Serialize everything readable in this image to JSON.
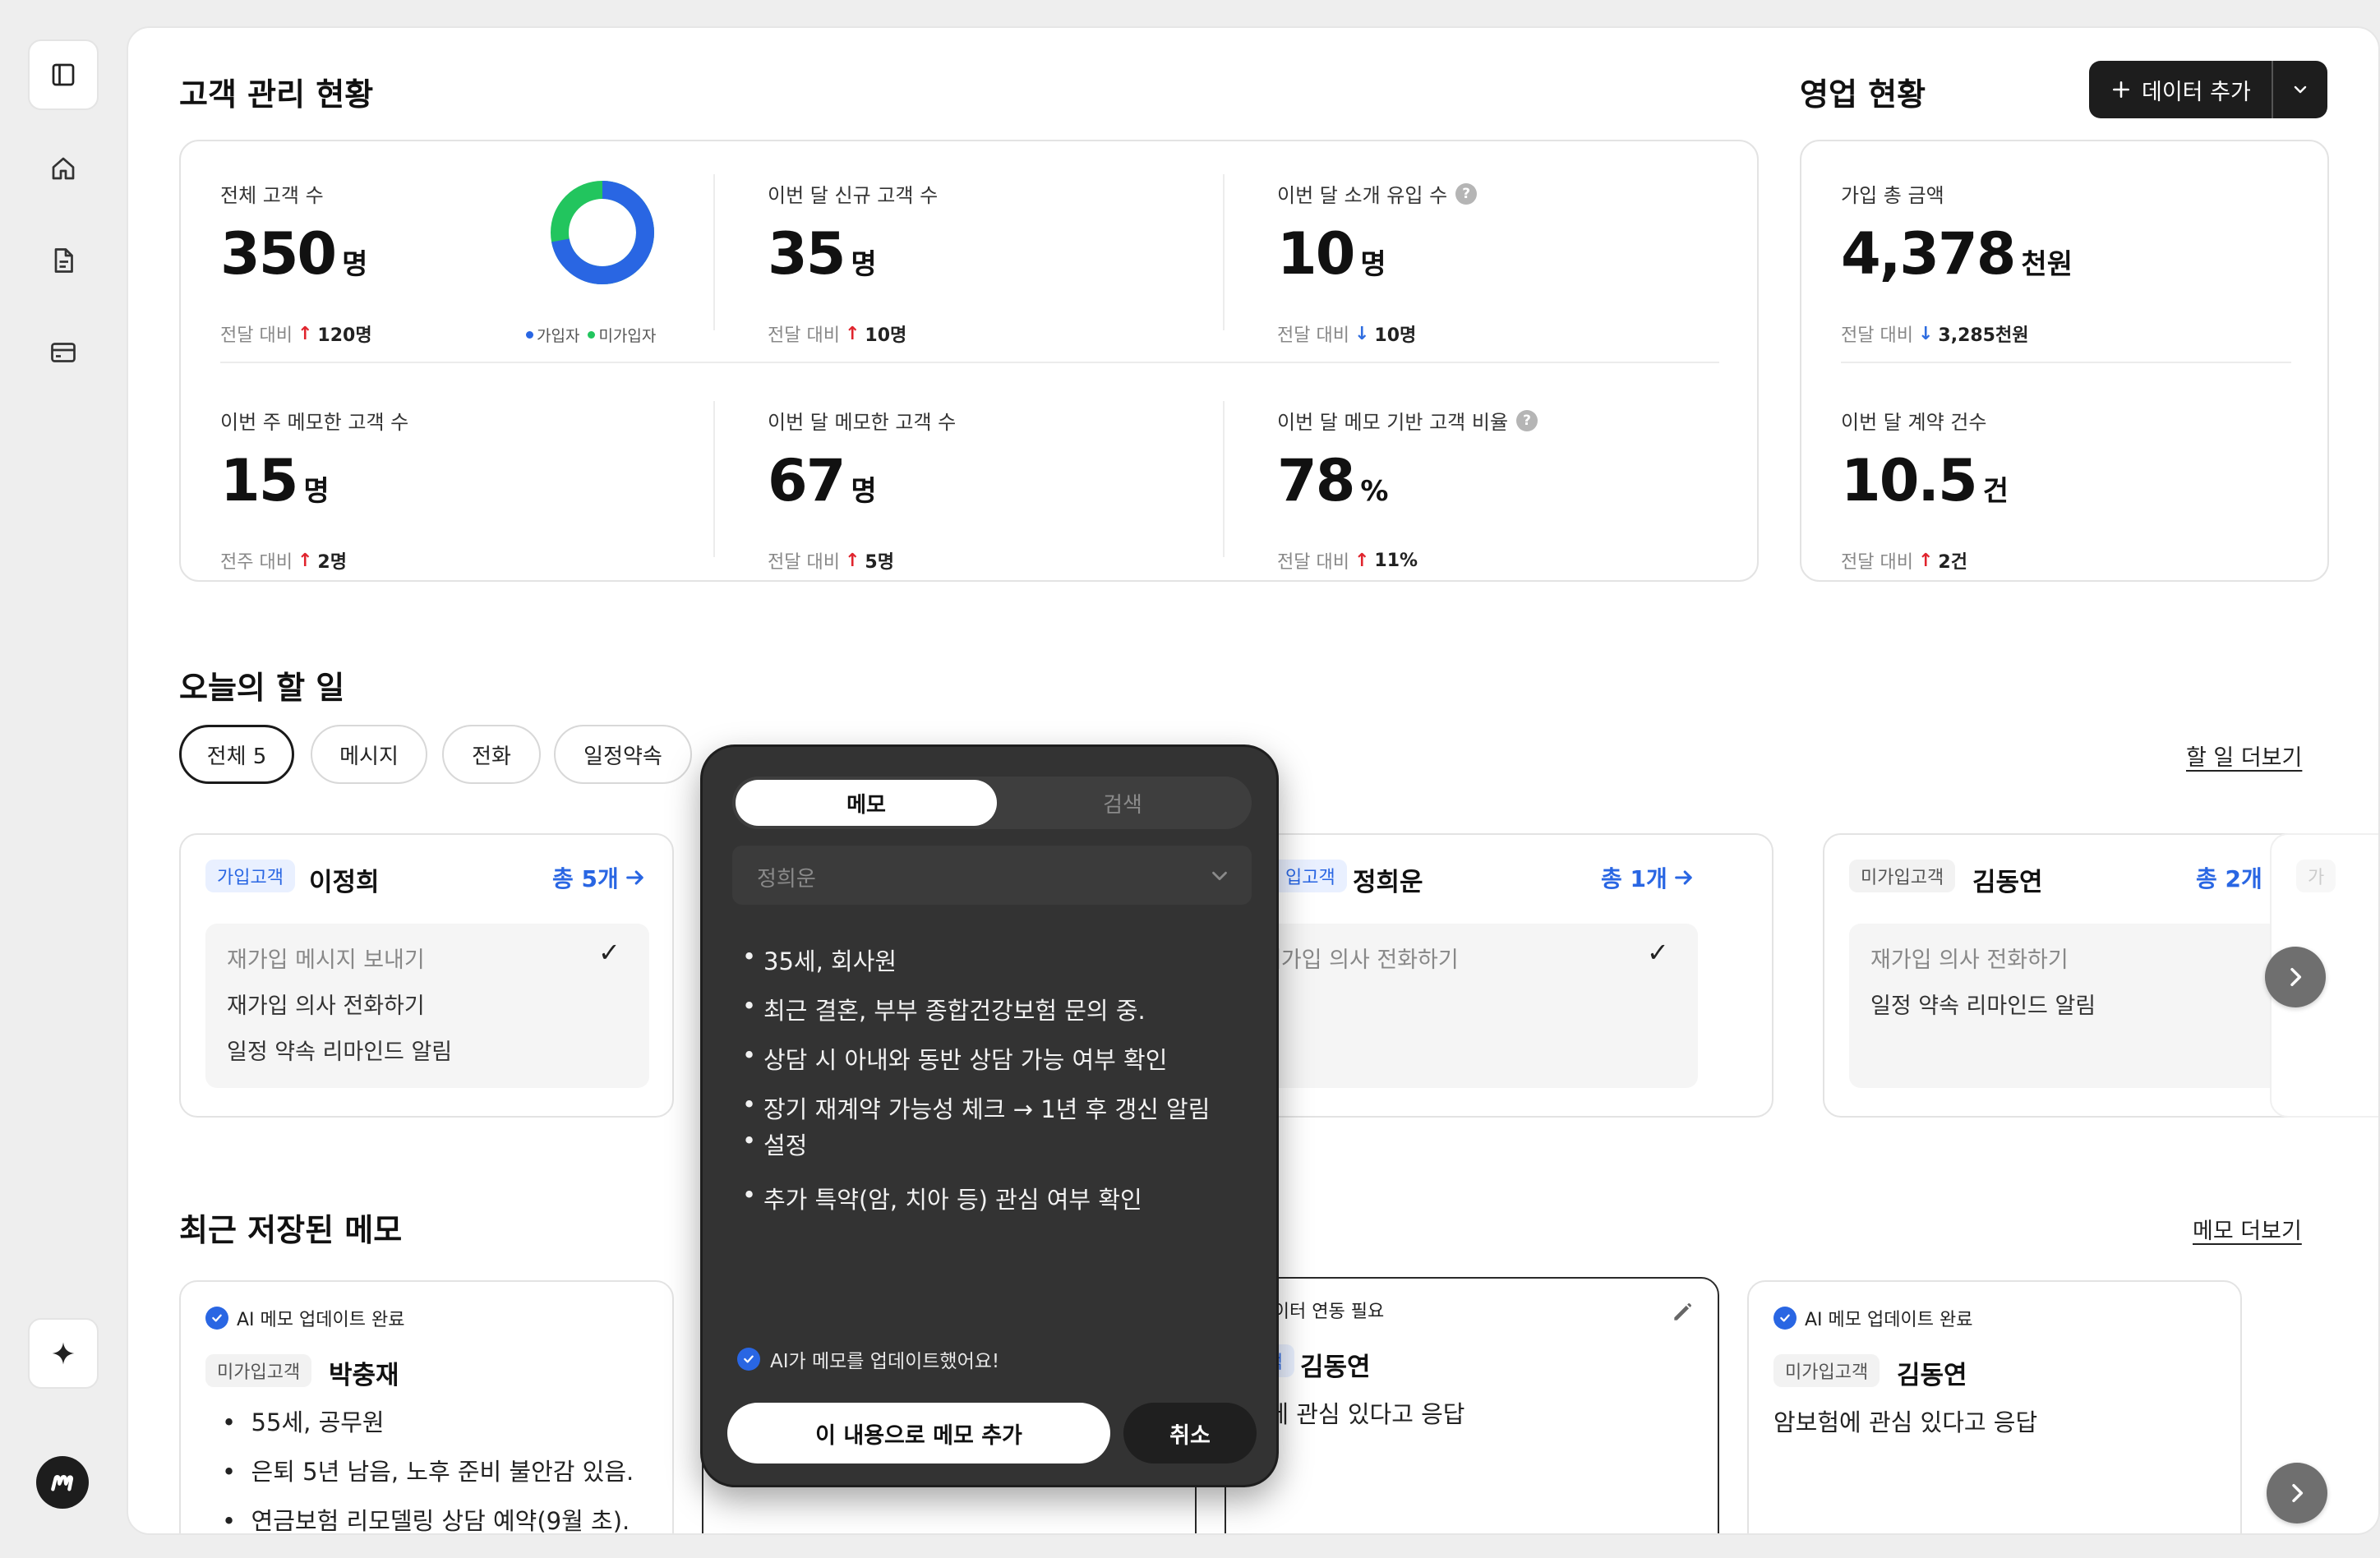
{
  "colors": {
    "accent_blue": "#2966e3",
    "accent_green": "#22c55e",
    "up_red": "#e0242d",
    "down_blue": "#2f6de0",
    "dark": "#1d1d1d"
  },
  "sidebar": {
    "items": [
      {
        "icon": "sidebar-toggle-icon"
      },
      {
        "icon": "home-icon"
      },
      {
        "icon": "document-icon"
      },
      {
        "icon": "card-icon"
      }
    ],
    "ai_button_icon": "sparkle-icon",
    "logo_icon": "brand-logo-icon"
  },
  "customer_section": {
    "title": "고객 관리 현황",
    "stats": [
      {
        "label": "전체 고객 수",
        "value": "350",
        "unit": "명",
        "compare_label": "전달 대비",
        "direction": "up",
        "delta": "120명"
      },
      {
        "label": "이번 달 신규 고객 수",
        "value": "35",
        "unit": "명",
        "compare_label": "전달 대비",
        "direction": "up",
        "delta": "10명"
      },
      {
        "label": "이번 달 소개 유입 수",
        "value": "10",
        "unit": "명",
        "compare_label": "전달 대비",
        "direction": "down",
        "delta": "10명",
        "help": "?"
      },
      {
        "label": "이번 주 메모한 고객 수",
        "value": "15",
        "unit": "명",
        "compare_label": "전주 대비",
        "direction": "up",
        "delta": "2명"
      },
      {
        "label": "이번 달 메모한 고객 수",
        "value": "67",
        "unit": "명",
        "compare_label": "전달 대비",
        "direction": "up",
        "delta": "5명"
      },
      {
        "label": "이번 달 메모 기반 고객 비율",
        "value": "78",
        "unit": "%",
        "compare_label": "전달 대비",
        "direction": "up",
        "delta": "11%",
        "help": "?"
      }
    ],
    "donut": {
      "legend": [
        "가입자",
        "미가입자"
      ],
      "joined_fraction": 0.72
    }
  },
  "sales_section": {
    "title": "영업 현황",
    "add_button": "데이터 추가",
    "stats": [
      {
        "label": "가입 총 금액",
        "value": "4,378",
        "unit": "천원",
        "compare_label": "전달 대비",
        "direction": "down",
        "delta": "3,285천원"
      },
      {
        "label": "이번 달 계약 건수",
        "value": "10.5",
        "unit": "건",
        "compare_label": "전달 대비",
        "direction": "up",
        "delta": "2건"
      }
    ]
  },
  "todo_section": {
    "title": "오늘의 할 일",
    "more_link": "할 일 더보기",
    "filters": [
      "전체 5",
      "메시지",
      "전화",
      "일정약속"
    ],
    "arrow_up": "↑",
    "arrow_down": "↓",
    "cards": [
      {
        "tag": "가입고객",
        "name": "이정희",
        "total": "총 5개",
        "tasks": [
          "재가입 메시지 보내기",
          "재가입 의사 전화하기",
          "일정 약속 리마인드 알림"
        ]
      },
      {
        "tag": "가입고객",
        "tag_visible": "입고객",
        "name": "정희운",
        "total": "총 1개",
        "tasks": [
          "재가입 의사 전화하기"
        ],
        "task_visible": "재가입 의사 전화하기"
      },
      {
        "tag": "미가입고객",
        "name": "김동연",
        "total": "총 2개",
        "tasks": [
          "재가입 의사 전화하기",
          "일정 약속 리마인드 알림"
        ]
      }
    ],
    "partial_tag": "가"
  },
  "memo_section": {
    "title": "최근 저장된 메모",
    "more_link": "메모 더보기",
    "cards": [
      {
        "status": "AI 메모 업데이트 완료",
        "tag": "미가입고객",
        "name": "박충재",
        "lines": [
          "55세, 공무원",
          "은퇴 5년 남음, 노후 준비 불안감 있음.",
          "연금보험 리모델링 상담 예약(9월 초)."
        ]
      },
      {
        "status": "AI 데이터 연동 필요",
        "tag_visible": "입고객",
        "name": "김동연",
        "text_visible": "보험에 관심 있다고 응답"
      },
      {
        "status": "AI 메모 업데이트 완료",
        "tag": "미가입고객",
        "name": "김동연",
        "text": "암보험에 관심 있다고 응답"
      }
    ]
  },
  "popup": {
    "tabs": [
      "메모",
      "검색"
    ],
    "select_value": "정희운",
    "bullets": [
      "35세, 회사원",
      "최근 결혼, 부부 종합건강보험 문의 중.",
      "상담 시 아내와 동반 상담 가능 여부 확인",
      "장기 재계약 가능성 체크 → 1년 후 갱신 알림",
      "추가 특약(암, 치아 등) 관심 여부 확인"
    ],
    "bullet_continuation": "설정",
    "status": "AI가 메모를 업데이트했어요!",
    "primary_button": "이 내용으로 메모 추가",
    "secondary_button": "취소"
  }
}
